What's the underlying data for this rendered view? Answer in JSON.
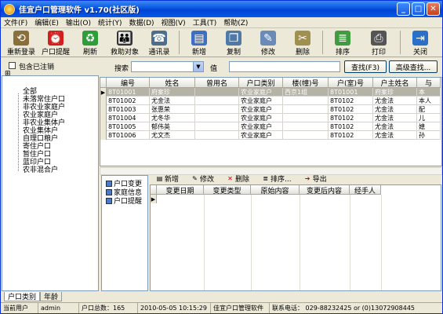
{
  "window": {
    "title": "佳宜户口管理软件 v1.70(社区版)"
  },
  "menu": [
    "文件(F)",
    "编辑(E)",
    "输出(O)",
    "统计(Y)",
    "数据(D)",
    "视图(V)",
    "工具(T)",
    "帮助(Z)"
  ],
  "toolbar": [
    {
      "label": "重新登录",
      "icon": "relogin-icon",
      "color": "#8a6e3c"
    },
    {
      "label": "户口提醒",
      "icon": "reminder-icon",
      "color": "#d02020"
    },
    {
      "label": "刷新",
      "icon": "refresh-icon",
      "color": "#2e9e3a"
    },
    {
      "label": "救助对象",
      "icon": "people-icon",
      "color": "#333333"
    },
    {
      "label": "通讯录",
      "icon": "contacts-icon",
      "color": "#4d6e8c"
    },
    {
      "label": "新增",
      "icon": "new-icon",
      "color": "#3d6fc4"
    },
    {
      "label": "复制",
      "icon": "copy-icon",
      "color": "#4d7aa8"
    },
    {
      "label": "修改",
      "icon": "edit-icon",
      "color": "#6a8ab8"
    },
    {
      "label": "删除",
      "icon": "delete-icon",
      "color": "#a09050"
    },
    {
      "label": "排序",
      "icon": "sort-icon",
      "color": "#3f9c3f"
    },
    {
      "label": "打印",
      "icon": "print-icon",
      "color": "#555555"
    },
    {
      "label": "关闭",
      "icon": "exit-icon",
      "color": "#2a70c8"
    }
  ],
  "search": {
    "include_cancelled": "包含已注销",
    "search_label": "搜索",
    "value_label": "值",
    "find_button": "查找(F3)",
    "advanced_button": "高级查找..."
  },
  "tree": {
    "items": [
      "全部",
      "未落常住户口",
      "非农业家庭户",
      "农业家庭户",
      "非农业集体户",
      "农业集体户",
      "自理口粮户",
      "寄住户口",
      "暂住户口",
      "蓝印户口",
      "农非混合户"
    ]
  },
  "left_tabs": [
    "户口类别",
    "年龄"
  ],
  "grid": {
    "columns": [
      "编号",
      "姓名",
      "曾用名",
      "户口类别",
      "楼(幢)号",
      "户(室)号",
      "户主姓名",
      "与"
    ],
    "rows": [
      [
        "8T01001",
        "府案珍",
        "",
        "农业家庭户",
        "西京1组",
        "8T01001",
        "府案珍",
        "本"
      ],
      [
        "8T01002",
        "尤金法",
        "",
        "农业家庭户",
        "",
        "8T0102",
        "尤金法",
        "本人"
      ],
      [
        "8T01003",
        "张惠荣",
        "",
        "农业家庭户",
        "",
        "8T0102",
        "尤金法",
        "配"
      ],
      [
        "8T01004",
        "尤冬华",
        "",
        "农业家庭户",
        "",
        "8T0102",
        "尤金法",
        "儿"
      ],
      [
        "8T01005",
        "郁伟英",
        "",
        "农业家庭户",
        "",
        "8T0102",
        "尤金法",
        "媳"
      ],
      [
        "8T01006",
        "尤文杰",
        "",
        "农业家庭户",
        "",
        "8T0102",
        "尤金法",
        "孙"
      ]
    ]
  },
  "detail_nav": [
    "户口变更",
    "家庭信息",
    "户口提醒"
  ],
  "detail_toolbar": [
    "新增",
    "修改",
    "删除",
    "排序...",
    "导出"
  ],
  "detail_grid": {
    "columns": [
      "变更日期",
      "变更类型",
      "原始内容",
      "变更后内容",
      "经手人"
    ]
  },
  "status": {
    "user_label": "当前用户",
    "user": "admin",
    "total": "户口总数：165",
    "datetime": "2010-05-05 10:15:29",
    "software": "佳宜户口管理软件",
    "contact": "联系电话：  029-88232425 or (0)13072908445"
  }
}
